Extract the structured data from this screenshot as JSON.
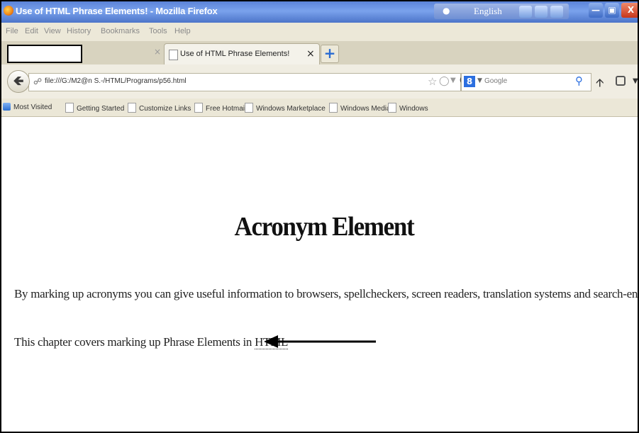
{
  "window": {
    "title": "Use of HTML Phrase Elements! - Mozilla Firefox",
    "language": "English"
  },
  "menu": [
    "File",
    "Edit",
    "View",
    "History",
    "Bookmarks",
    "Tools",
    "Help"
  ],
  "tabs": {
    "active_title": "Use of HTML Phrase Elements!",
    "close_glyph": "×",
    "new_tab_glyph": "+"
  },
  "nav": {
    "url": "file:///G:/M2@n S.-/HTML/Programs/p56.html",
    "search_placeholder": "Google"
  },
  "bookmarks": [
    "Most Visited",
    "Getting Started",
    "Customize Links",
    "Free Hotmail",
    "Windows Marketplace",
    "Windows Media",
    "Windows"
  ],
  "page": {
    "heading": "Acronym Element",
    "paragraph1": "By marking up acronyms you can give useful information to browsers, spellcheckers, screen readers, translation systems and search-engines.",
    "paragraph2_prefix": "This chapter covers marking up Phrase Elements in ",
    "acronym": "HTML"
  },
  "icons": {
    "back": "back-arrow-icon",
    "reload": "reload-icon",
    "home": "home-icon",
    "annotation": "pointing-arrow"
  },
  "colors": {
    "titlebar": "#5b83d8",
    "close_button": "#c7361a",
    "chrome": "#ece8d8"
  }
}
